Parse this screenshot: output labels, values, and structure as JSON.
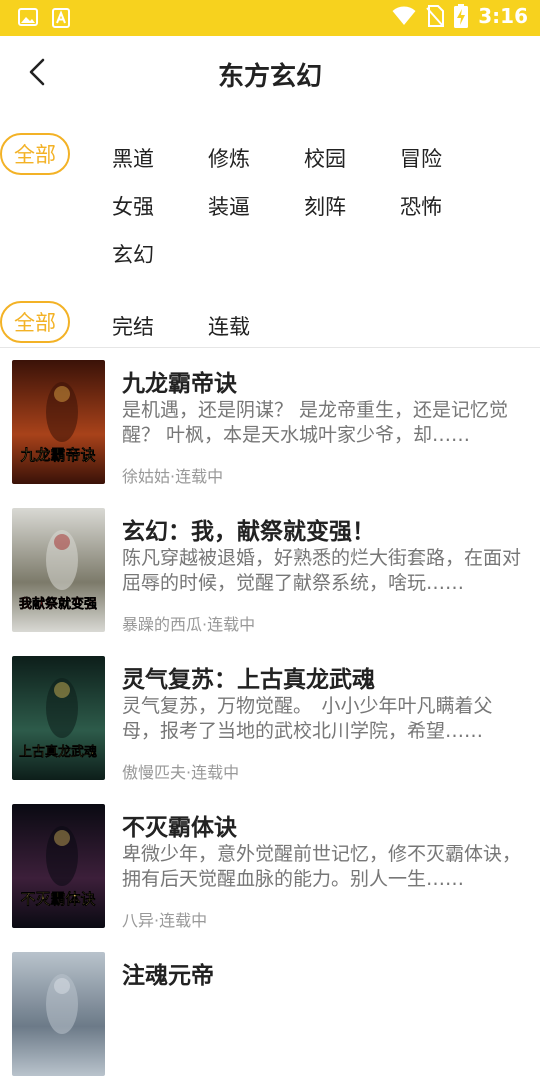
{
  "status_bar": {
    "time": "3:16",
    "icons": [
      "gallery-icon",
      "notification-a-icon",
      "wifi-icon",
      "no-sim-icon",
      "battery-charging-icon"
    ]
  },
  "header": {
    "back_icon": "chevron-left-icon",
    "title": "东方玄幻"
  },
  "category_filter": {
    "all_label": "全部",
    "tags": [
      "黑道",
      "修炼",
      "校园",
      "冒险",
      "女强",
      "装逼",
      "刻阵",
      "恐怖",
      "玄幻"
    ]
  },
  "status_filter": {
    "all_label": "全部",
    "options": [
      "完结",
      "连载"
    ]
  },
  "books": [
    {
      "title": "九龙霸帝诀",
      "desc": "是机遇，还是阴谋？ 是龙帝重生，还是记忆觉醒？ 叶枫，本是天水城叶家少爷，却……",
      "meta": "徐姑姑·连载中",
      "cover_text": "九龙霸帝诀",
      "cover_colors": [
        "#3a1208",
        "#a8421a",
        "#e9b24a"
      ]
    },
    {
      "title": "玄幻：我，献祭就变强！",
      "desc": "陈凡穿越被退婚，好熟悉的烂大街套路，在面对屈辱的时候，觉醒了献祭系统，啥玩……",
      "meta": "暴躁的西瓜·连载中",
      "cover_text": "我献祭就变强",
      "cover_colors": [
        "#d9d9d4",
        "#7c7a6a",
        "#a01818"
      ]
    },
    {
      "title": "灵气复苏：上古真龙武魂",
      "desc": "灵气复苏，万物觉醒。　小小少年叶凡瞒着父母，报考了当地的武校北川学院，希望……",
      "meta": "傲慢匹夫·连载中",
      "cover_text": "上古真龙武魂",
      "cover_colors": [
        "#0d1e1a",
        "#2d5b4a",
        "#e3c15a"
      ]
    },
    {
      "title": "不灭霸体诀",
      "desc": "卑微少年，意外觉醒前世记忆，修不灭霸体诀，拥有后天觉醒血脉的能力。别人一生……",
      "meta": "八异·连载中",
      "cover_text": "不灭霸体诀",
      "cover_colors": [
        "#0a0a12",
        "#3c1f3a",
        "#d2b45a"
      ]
    },
    {
      "title": "注魂元帝",
      "desc": "",
      "meta": "",
      "cover_text": "",
      "cover_colors": [
        "#b9c3cc",
        "#6c7a88",
        "#dfe5ea"
      ]
    }
  ]
}
